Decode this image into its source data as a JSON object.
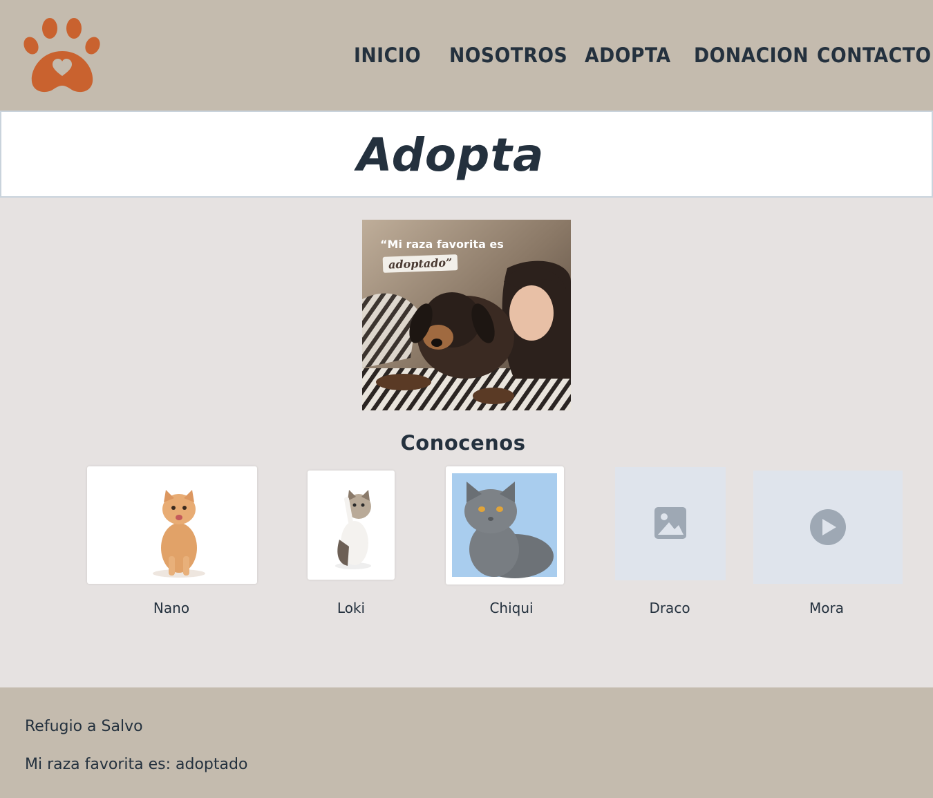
{
  "header": {
    "logo_icon": "paw-heart-icon",
    "nav": [
      "INICIO",
      "NOSOTROS",
      "ADOPTA",
      "DONACION",
      "CONTACTO"
    ]
  },
  "main": {
    "title": "Adopta",
    "hero": {
      "quote": "“Mi raza favorita es",
      "badge": "adoptado”"
    },
    "section_title": "Conocenos",
    "pets": [
      {
        "name": "Nano",
        "image": "orange-kitten-photo"
      },
      {
        "name": "Loki",
        "image": "tabby-kitten-photo"
      },
      {
        "name": "Chiqui",
        "image": "grey-cat-photo"
      },
      {
        "name": "Draco",
        "image": "image-placeholder-icon"
      },
      {
        "name": "Mora",
        "image": "video-play-icon"
      }
    ]
  },
  "footer": {
    "line1": "Refugio a Salvo",
    "line2": "Mi raza favorita es: adoptado"
  },
  "colors": {
    "header_bg": "#c4bbae",
    "body_bg": "#e6e2e1",
    "text": "#24313e",
    "brand": "#c9622f",
    "placeholder_bg": "#dfe4ec",
    "placeholder_icon": "#9ea8b4"
  }
}
